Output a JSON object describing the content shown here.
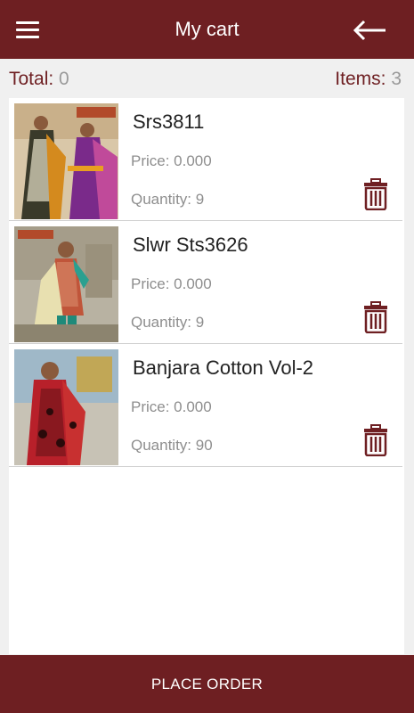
{
  "header": {
    "title": "My cart"
  },
  "summary": {
    "total_label": "Total:",
    "total_value": "0",
    "items_label": "Items:",
    "items_value": "3"
  },
  "cart": {
    "items": [
      {
        "name": "Srs3811",
        "price": "Price: 0.000",
        "quantity": "Quantity: 9"
      },
      {
        "name": "Slwr Sts3626",
        "price": "Price: 0.000",
        "quantity": "Quantity: 9"
      },
      {
        "name": "Banjara Cotton Vol-2",
        "price": "Price: 0.000",
        "quantity": "Quantity: 90"
      }
    ]
  },
  "footer": {
    "place_order_label": "PLACE ORDER"
  },
  "colors": {
    "primary": "#6e1f22",
    "background": "#f0f0f0",
    "card": "#ffffff"
  }
}
